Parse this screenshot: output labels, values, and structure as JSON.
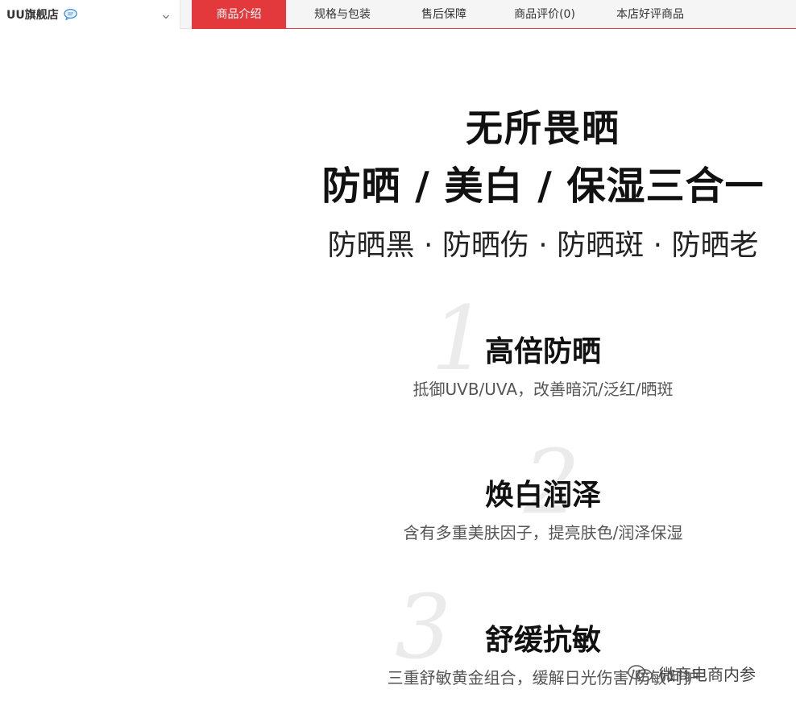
{
  "store": {
    "name": "UU旗舰店",
    "chat_icon": "chat-bubble-icon",
    "dropdown_icon": "chevron-down-icon"
  },
  "tabs": [
    {
      "label": "商品介绍",
      "active": true
    },
    {
      "label": "规格与包装",
      "active": false
    },
    {
      "label": "售后保障",
      "active": false
    },
    {
      "label": "商品评价(0)",
      "active": false
    },
    {
      "label": "本店好评商品",
      "active": false
    }
  ],
  "colors": {
    "accent": "#e4393c",
    "tab_bar": "#f5f5f5"
  },
  "hero": {
    "line1": "无所畏晒",
    "line2": "防晒 / 美白 / 保湿三合一",
    "line3": "防晒黑 · 防晒伤 · 防晒斑 · 防晒老"
  },
  "features": [
    {
      "number": "1",
      "title": "高倍防晒",
      "desc": "抵御UVB/UVA，改善暗沉/泛红/晒斑"
    },
    {
      "number": "2",
      "title": "焕白润泽",
      "desc": "含有多重美肤因子，提亮肤色/润泽保湿"
    },
    {
      "number": "3",
      "title": "舒缓抗敏",
      "desc": "三重舒敏黄金组合，缓解日光伤害/防敏呵护"
    }
  ],
  "watermark": {
    "text": "微商电商内参",
    "icon": "wechat-icon"
  }
}
